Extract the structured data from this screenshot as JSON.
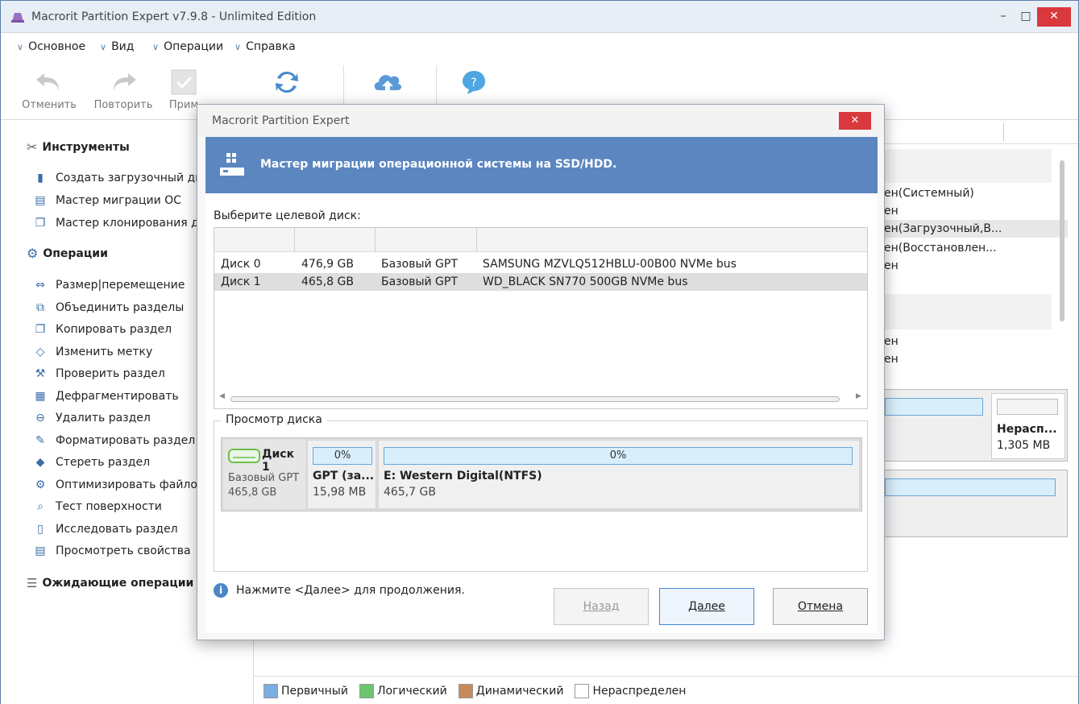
{
  "window": {
    "title": "Macrorit Partition Expert v7.9.8 - Unlimited Edition",
    "minimize": "–",
    "maximize": "□",
    "close": "✕"
  },
  "menu": [
    {
      "label": "Основное"
    },
    {
      "label": "Вид"
    },
    {
      "label": "Операции"
    },
    {
      "label": "Справка"
    }
  ],
  "toolbar": {
    "undo": "Отменить",
    "redo": "Повторить",
    "apply": "Прим"
  },
  "sidebar": {
    "tools_title": "Инструменты",
    "tools": [
      {
        "label": "Создать загрузочный ди"
      },
      {
        "label": "Мастер миграции ОС"
      },
      {
        "label": "Мастер клонирования д"
      }
    ],
    "ops_title": "Операции",
    "ops": [
      {
        "label": "Размер|перемещение"
      },
      {
        "label": "Объединить разделы"
      },
      {
        "label": "Копировать раздел"
      },
      {
        "label": "Изменить метку"
      },
      {
        "label": "Проверить раздел"
      },
      {
        "label": "Дефрагментировать"
      },
      {
        "label": "Удалить раздел"
      },
      {
        "label": "Форматировать раздел"
      },
      {
        "label": "Стереть раздел"
      },
      {
        "label": "Оптимизировать файлов"
      },
      {
        "label": "Тест поверхности"
      },
      {
        "label": "Исследовать раздел"
      },
      {
        "label": "Просмотреть свойства"
      }
    ],
    "pending_title": "Ожидающие операции"
  },
  "right_list": {
    "rows": [
      "ен(Системный)",
      "ен",
      "ен(Загрузочный,В...",
      "ен(Восстановлен...",
      "ен",
      "ен",
      "ен"
    ],
    "unalloc_label": "Нерасп...",
    "unalloc_size": "1,305 MB"
  },
  "legend": {
    "primary": "Первичный",
    "logical": "Логический",
    "dynamic": "Динамический",
    "unallocated": "Нераспределен"
  },
  "dialog": {
    "title": "Macrorit Partition Expert",
    "close": "✕",
    "banner": "Мастер миграции операционной системы на SSD/HDD.",
    "prompt": "Выберите целевой диск:",
    "disks": [
      {
        "name": "Диск 0",
        "size": "476,9 GB",
        "type": "Базовый GPT",
        "model": "SAMSUNG MZVLQ512HBLU-00B00 NVMe bus"
      },
      {
        "name": "Диск 1",
        "size": "465,8 GB",
        "type": "Базовый GPT",
        "model": "WD_BLACK SN770 500GB NVMe bus"
      }
    ],
    "preview_title": "Просмотр диска",
    "preview": {
      "disk_name": "Диск 1",
      "disk_type": "Базовый GPT",
      "disk_size": "465,8 GB",
      "p1_pct": "0%",
      "p1_name": "GPT (за...",
      "p1_size": "15,98 MB",
      "p2_pct": "0%",
      "p2_name": "E: Western Digital(NTFS)",
      "p2_size": "465,7 GB"
    },
    "hint": "Нажмите <Далее> для продолжения.",
    "back": "Назад",
    "next": "Далее",
    "cancel": "Отмена"
  },
  "colors": {
    "banner": "#5c86c0",
    "close_red": "#d9383d",
    "legend_primary": "#7aaee0",
    "legend_logical": "#6cc46c",
    "legend_dynamic": "#c98a5a"
  }
}
